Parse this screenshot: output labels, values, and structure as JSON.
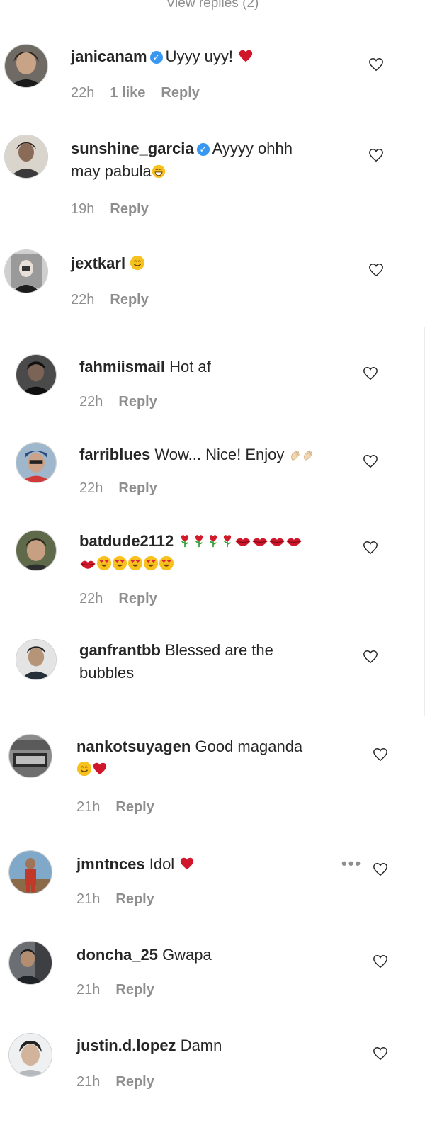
{
  "view_replies": "View replies (2)",
  "reply_label": "Reply",
  "colors": {
    "heart_red": "#ed4956",
    "verified_blue": "#3897f0",
    "meta_gray": "#8e8e8e"
  },
  "comments": [
    {
      "username": "janicanam",
      "verified": true,
      "text": "Uyyy uyy!",
      "emojis": [
        "red-heart"
      ],
      "time": "22h",
      "likes": "1 like"
    },
    {
      "username": "sunshine_garcia",
      "verified": true,
      "text": "Ayyyy ohhh",
      "text2": "may pabula",
      "emojis": [
        "grinning-face"
      ],
      "time": "19h"
    },
    {
      "username": "jextkarl",
      "verified": false,
      "text": "",
      "emojis": [
        "smiling-face"
      ],
      "time": "22h"
    },
    {
      "username": "fahmiismail",
      "verified": false,
      "text": "Hot af",
      "time": "22h"
    },
    {
      "username": "farriblues",
      "verified": false,
      "text": "Wow... Nice! Enjoy",
      "emojis": [
        "clapping-hands"
      ],
      "time": "22h"
    },
    {
      "username": "batdude2112",
      "verified": false,
      "text": "",
      "emojis": [
        "rose",
        "rose",
        "rose",
        "rose",
        "kiss-mark",
        "kiss-mark",
        "kiss-mark",
        "kiss-mark",
        "kiss-mark",
        "heart-eyes",
        "heart-eyes",
        "heart-eyes",
        "heart-eyes",
        "heart-eyes"
      ],
      "time": "22h"
    },
    {
      "username": "ganfrantbb",
      "verified": false,
      "text": "Blessed are the",
      "text2": "bubbles"
    },
    {
      "username": "nankotsuyagen",
      "verified": false,
      "text": "Good maganda",
      "emojis": [
        "smiling-face",
        "red-heart"
      ],
      "time": "21h"
    },
    {
      "username": "jmntnces",
      "verified": false,
      "text": "Idol",
      "emojis": [
        "red-heart"
      ],
      "time": "21h",
      "more_icon": "more-dots"
    },
    {
      "username": "doncha_25",
      "verified": false,
      "text": "Gwapa",
      "time": "21h"
    },
    {
      "username": "justin.d.lopez",
      "verified": false,
      "text": "Damn",
      "time": "21h"
    }
  ]
}
